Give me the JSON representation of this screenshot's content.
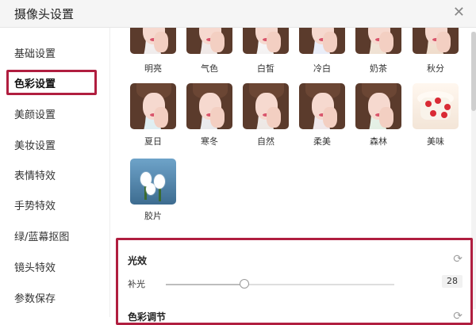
{
  "window": {
    "title": "摄像头设置"
  },
  "sidebar": {
    "items": [
      {
        "label": "基础设置"
      },
      {
        "label": "色彩设置",
        "active": true
      },
      {
        "label": "美颜设置"
      },
      {
        "label": "美妆设置"
      },
      {
        "label": "表情特效"
      },
      {
        "label": "手势特效"
      },
      {
        "label": "绿/蓝幕抠图"
      },
      {
        "label": "镜头特效"
      },
      {
        "label": "参数保存"
      }
    ]
  },
  "filters": {
    "row1": [
      "明亮",
      "气色",
      "白皙",
      "冷白",
      "奶茶",
      "秋分"
    ],
    "row2": [
      "夏日",
      "寒冬",
      "自然",
      "柔美",
      "森林",
      "美味"
    ],
    "row3": [
      "胶片"
    ]
  },
  "light_effect": {
    "title": "光效",
    "slider_label": "补光",
    "slider_value": "28",
    "slider_fraction": 0.34
  },
  "color_adjust": {
    "title": "色彩调节"
  },
  "colors": {
    "accent": "#b01e3f"
  }
}
